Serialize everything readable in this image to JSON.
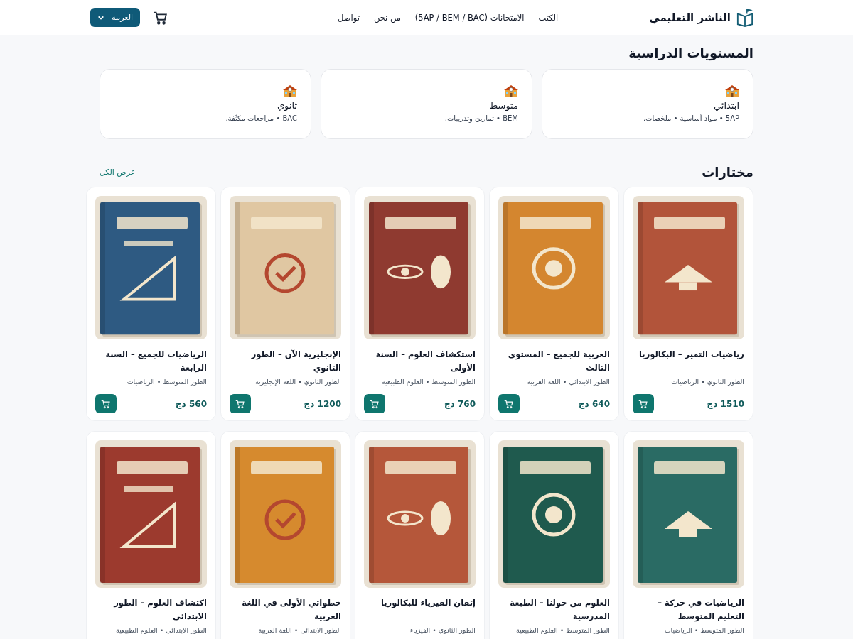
{
  "header": {
    "logo": "الناشر التعليمي",
    "nav": [
      "الكتب",
      "الامتحانات (5AP / BEM / BAC)",
      "من نحن",
      "تواصل"
    ],
    "language": "العربية"
  },
  "levels": {
    "title": "المستويات الدراسية",
    "items": [
      {
        "title": "ابتدائي",
        "subtitle": "5AP • مواد أساسية • ملخصات."
      },
      {
        "title": "متوسط",
        "subtitle": "BEM • تمارين وتدريبات."
      },
      {
        "title": "ثانوي",
        "subtitle": "BAC • مراجعات مكثّفة."
      }
    ]
  },
  "featured": {
    "title": "مختارات",
    "view_all": "عرض الكل",
    "products": [
      {
        "title": "رياضيات التميز – البكالوريا",
        "meta": "الطور الثانوي • الرياضيات",
        "price": "1510 دج"
      },
      {
        "title": "العربية للجميع – المستوى الثالث",
        "meta": "الطور الابتدائي • اللغة العربية",
        "price": "640 دج"
      },
      {
        "title": "استكشاف العلوم – السنة الأولى",
        "meta": "الطور المتوسط • العلوم الطبيعية",
        "price": "760 دج"
      },
      {
        "title": "الإنجليزية الآن – الطور الثانوي",
        "meta": "الطور الثانوي • اللغة الإنجليزية",
        "price": "1200 دج"
      },
      {
        "title": "الرياضيات للجميع – السنة الرابعة",
        "meta": "الطور المتوسط • الرياضيات",
        "price": "560 دج"
      },
      {
        "title": "الرياضيات في حركة – التعليم المتوسط",
        "meta": "الطور المتوسط • الرياضيات"
      },
      {
        "title": "العلوم من حولنا – الطبعة المدرسية",
        "meta": "الطور المتوسط • العلوم الطبيعية"
      },
      {
        "title": "إتقان الفيزياء للبكالوريا",
        "meta": "الطور الثانوي • الفيزياء"
      },
      {
        "title": "خطواتي الأولى في اللغة العربية",
        "meta": "الطور الابتدائي • اللغة العربية"
      },
      {
        "title": "اكتشاف العلوم – الطور الابتدائي",
        "meta": "الطور الابتدائي • العلوم الطبيعية"
      }
    ]
  }
}
